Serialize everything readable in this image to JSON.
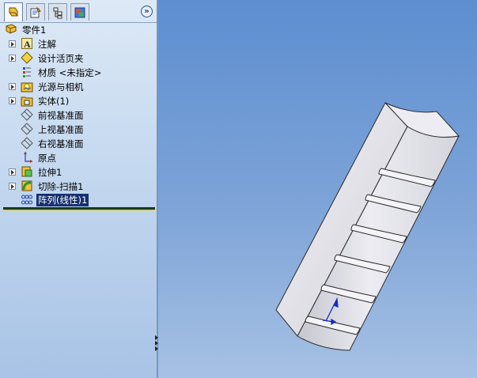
{
  "tabs": [
    {
      "name": "feature-manager",
      "icon": "feature-tree-icon",
      "active": true
    },
    {
      "name": "property-manager",
      "icon": "property-icon",
      "active": false
    },
    {
      "name": "configuration-manager",
      "icon": "configuration-icon",
      "active": false
    },
    {
      "name": "display-manager",
      "icon": "display-icon",
      "active": false
    }
  ],
  "tree": {
    "root_label": "零件1",
    "items": [
      {
        "label": "注解",
        "icon": "annotations-icon",
        "expandable": true
      },
      {
        "label": "设计活页夹",
        "icon": "design-binder-icon",
        "expandable": true
      },
      {
        "label": "材质 <未指定>",
        "icon": "material-icon",
        "expandable": false
      },
      {
        "label": "光源与相机",
        "icon": "lights-cameras-icon",
        "expandable": true
      },
      {
        "label": "实体(1)",
        "icon": "solid-bodies-icon",
        "expandable": true
      },
      {
        "label": "前视基准面",
        "icon": "plane-icon",
        "expandable": false
      },
      {
        "label": "上视基准面",
        "icon": "plane-icon",
        "expandable": false
      },
      {
        "label": "右视基准面",
        "icon": "plane-icon",
        "expandable": false
      },
      {
        "label": "原点",
        "icon": "origin-icon",
        "expandable": false
      },
      {
        "label": "拉伸1",
        "icon": "extrude-icon",
        "expandable": true
      },
      {
        "label": "切除-扫描1",
        "icon": "cut-sweep-icon",
        "expandable": true
      },
      {
        "label": "阵列(线性)1",
        "icon": "linear-pattern-icon",
        "expandable": false,
        "selected": true
      }
    ]
  },
  "colors": {
    "selection": "#16306e",
    "model_face": "#e8e8ee",
    "model_edge": "#2a2a2a",
    "viewport_top": "#5d8ed0",
    "viewport_bottom": "#a6c1e4"
  }
}
